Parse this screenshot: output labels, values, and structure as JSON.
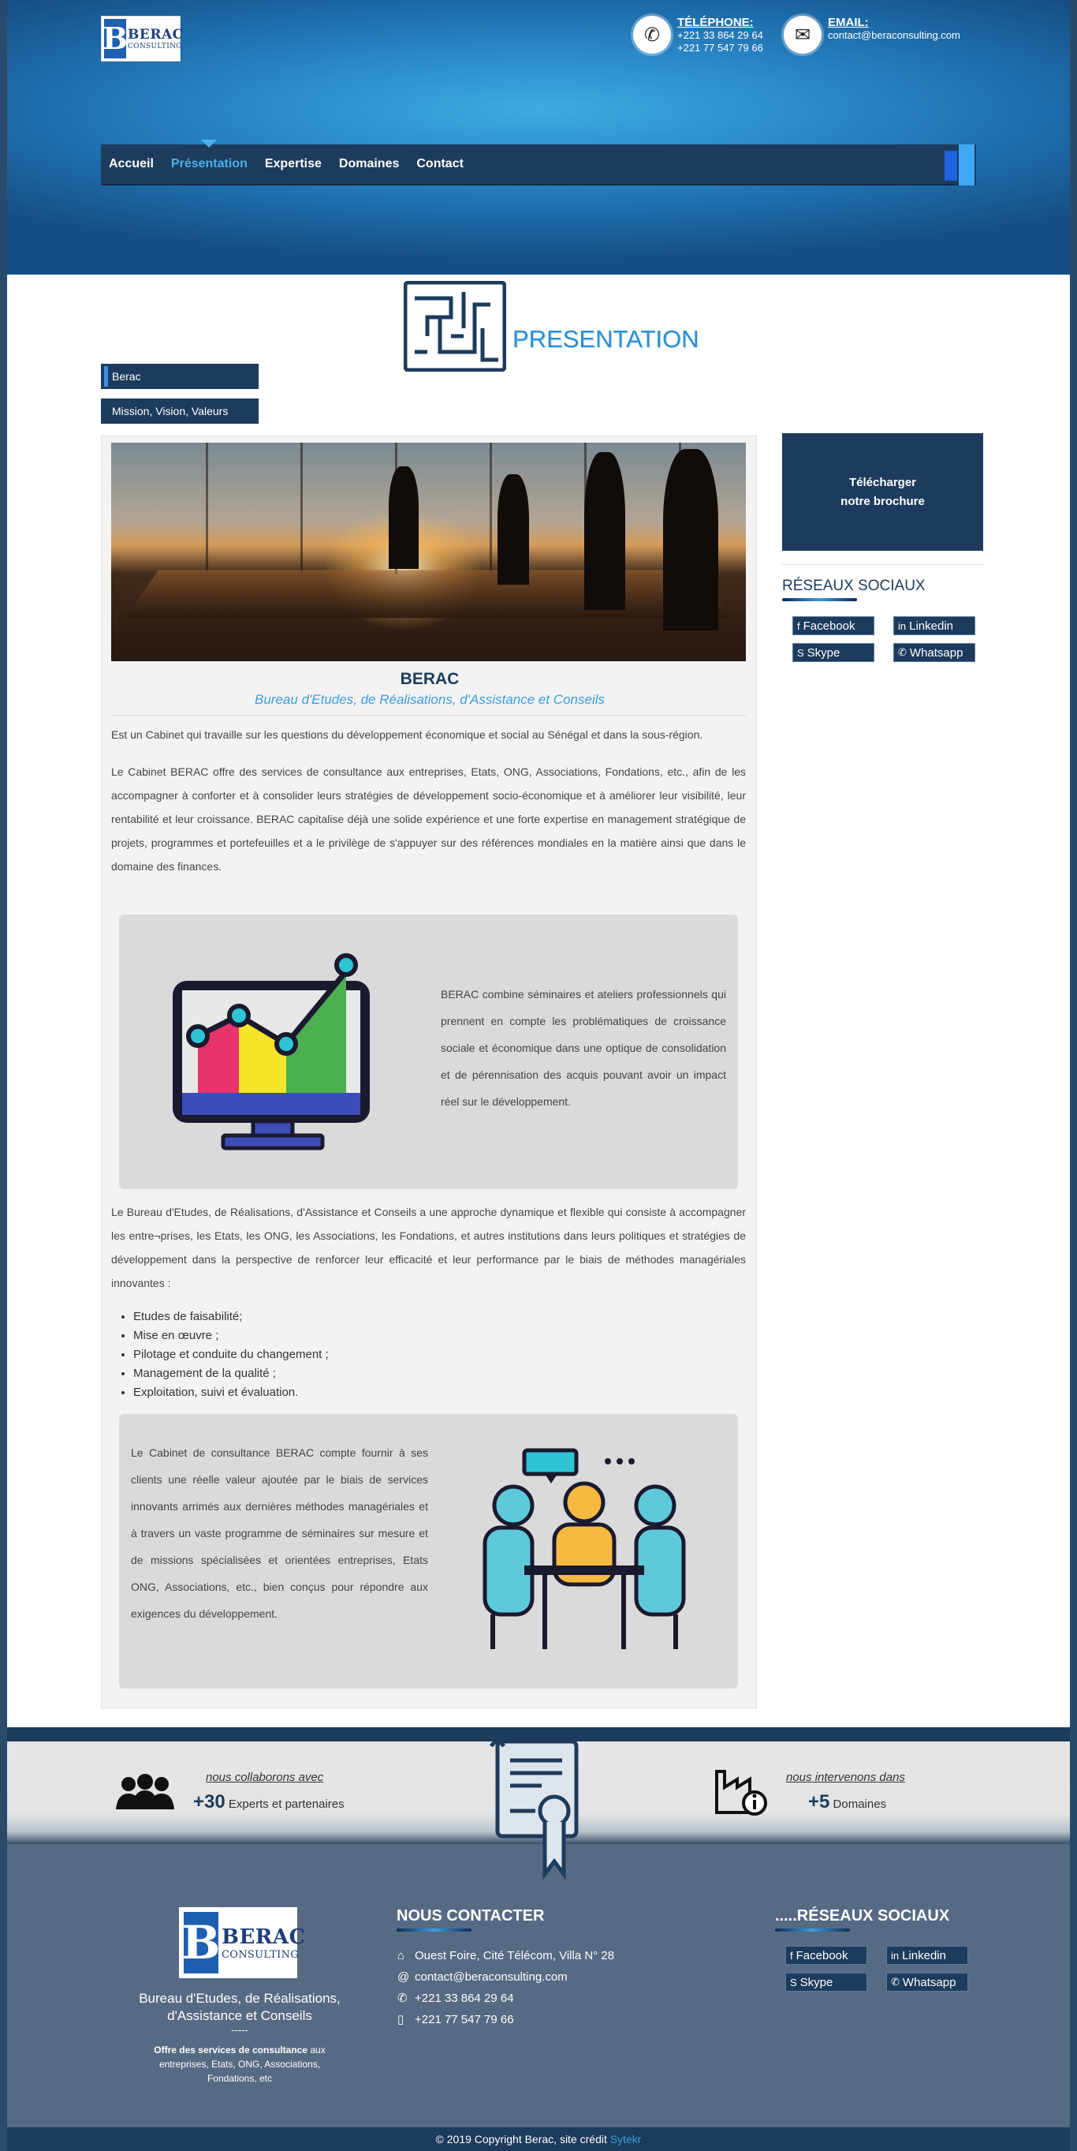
{
  "header": {
    "logo": {
      "letter": "B",
      "line1": "BERAC",
      "line2": "CONSULTING"
    },
    "phone": {
      "icon": "phone-icon",
      "title": "TÉLÉPHONE:",
      "lines": [
        "+221 33 864 29 64",
        "+221 77 547 79 66"
      ]
    },
    "email": {
      "icon": "mail-icon",
      "title": "EMAIL:",
      "value": "contact@beraconsulting.com"
    }
  },
  "nav": {
    "items": [
      {
        "label": "Accueil"
      },
      {
        "label": "Présentation",
        "active": true
      },
      {
        "label": "Expertise"
      },
      {
        "label": "Domaines"
      },
      {
        "label": "Contact"
      }
    ]
  },
  "page": {
    "title": "PRESENTATION",
    "tabs": [
      {
        "label": "Berac",
        "active": true
      },
      {
        "label": "Mission, Vision, Valeurs"
      }
    ]
  },
  "main": {
    "title": "BERAC",
    "subtitle": "Bureau d'Etudes, de Réalisations, d'Assistance et Conseils",
    "p1": "Est un Cabinet qui travaille sur les questions du développement économique et social au Sénégal et dans la sous-région.",
    "p2": "Le Cabinet BERAC offre des services de consultance aux entreprises, Etats, ONG, Associations, Fondations, etc., afin de les accompagner à conforter et à consolider leurs stratégies de développement socio-économique et à améliorer leur visibilité, leur rentabilité et leur croissance. BERAC capitalise déjà une solide expérience et une forte expertise en management stratégique de projets, programmes et portefeuilles et a le privilège de s'appuyer sur des références mondiales en la matière ainsi que dans le domaine des finances.",
    "panel1": "BERAC combine séminaires et ateliers professionnels qui prennent en compte les problématiques de croissance sociale et économique dans une optique de consolidation et de pérennisation des acquis pouvant avoir un impact réel sur le développement.",
    "p3": "Le Bureau d'Etudes, de Réalisations, d'Assistance et Conseils a une approche dynamique et flexible qui consiste à accompagner les entre¬prises, les Etats, les ONG, les Associations, les Fondations, et autres institutions dans leurs politiques et stratégies de développement dans la perspective de renforcer leur efficacité et leur performance par le biais de méthodes managériales innovantes :",
    "bullets": [
      "Etudes de faisabilité;",
      "Mise en œuvre ;",
      "Pilotage et conduite du changement ;",
      "Management de la qualité ;",
      "Exploitation, suivi et évaluation."
    ],
    "panel2": "Le Cabinet de consultance BERAC compte fournir à ses clients une réelle valeur ajoutée par le biais de services innovants arrimés aux dernières méthodes managériales et à travers un vaste programme de séminaires sur mesure et de missions spécialisées et orientées entreprises, Etats ONG, Associations, etc., bien conçus pour répondre aux exigences du développement."
  },
  "sidebar": {
    "brochure": "Télécharger notre brochure",
    "social_title": "RÉSEAUX SOCIAUX",
    "social": [
      {
        "label": "Facebook",
        "icon": "f"
      },
      {
        "label": "Linkedin",
        "icon": "in"
      },
      {
        "label": "Skype",
        "icon": "S"
      },
      {
        "label": "Whatsapp",
        "icon": "✆"
      }
    ]
  },
  "stats": {
    "left": {
      "caption": "nous collaborons avec",
      "number": "+30",
      "unit": "Experts et partenaires"
    },
    "right": {
      "caption": "nous intervenons dans",
      "number": "+5",
      "unit": "Domaines"
    }
  },
  "footer": {
    "logo": {
      "letter": "B",
      "line1": "BERAC",
      "line2": "CONSULTING"
    },
    "name": "Bureau d'Etudes, de Réalisations, d'Assistance et Conseils",
    "dots": "-----",
    "offer_bold": "Offre des services de consultance",
    "offer_rest": " aux entreprises, Etats, ONG, Associations, Fondations, etc",
    "contact_title": "NOUS CONTACTER",
    "address": "Ouest Foire, Cité Télécom, Villa N° 28",
    "email": "contact@beraconsulting.com",
    "phone1": "+221 33 864 29 64",
    "phone2": "+221 77 547 79 66",
    "social_title": ".....RÉSEAUX SOCIAUX",
    "social": [
      {
        "label": "Facebook",
        "icon": "f"
      },
      {
        "label": "Linkedin",
        "icon": "in"
      },
      {
        "label": "Skype",
        "icon": "S"
      },
      {
        "label": "Whatsapp",
        "icon": "✆"
      }
    ]
  },
  "copyright": {
    "text": "© 2019 Copyright Berac, site crédit ",
    "link": "Sytekr"
  },
  "colors": {
    "navy": "#1d3b5c",
    "accent": "#3a9ee0",
    "footer": "#566a83"
  }
}
